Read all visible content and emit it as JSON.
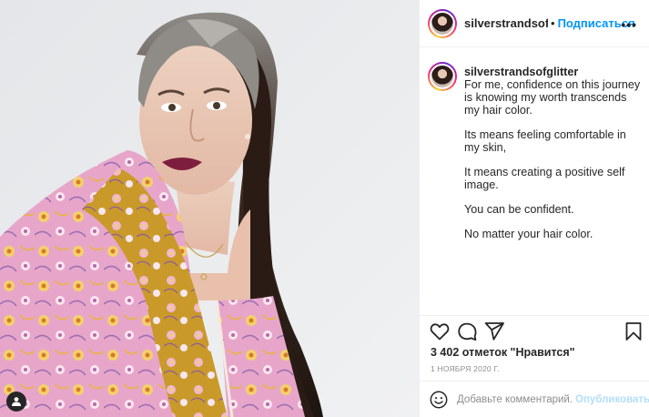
{
  "post": {
    "username": "silverstrandsofglitter",
    "follow_label": "Подписаться",
    "separator": "•",
    "more": "•••",
    "caption": {
      "username": "silverstrandsofglitter",
      "paragraphs": [
        "For me, confidence on this journey is knowing my worth transcends my hair color.",
        "Its means feeling comfortable in my skin,",
        "It means creating a positive self image.",
        "You can be confident.",
        "No matter your hair color."
      ]
    },
    "likes_text": "3 402 отметок \"Нравится\"",
    "date_text": "1 НОЯБРЯ 2020 Г.",
    "comment_placeholder": "Добавьте комментарий...",
    "publish_label": "Опубликовать"
  },
  "icons": {
    "like": "heart-icon",
    "comment": "comment-icon",
    "share": "paper-plane-icon",
    "save": "bookmark-icon",
    "emoji": "emoji-icon",
    "tagged_users": "user-tag-icon"
  },
  "colors": {
    "accent": "#0095f6",
    "publish_disabled": "#b2dffc",
    "muted": "#8e8e8e",
    "divider": "#efefef"
  }
}
